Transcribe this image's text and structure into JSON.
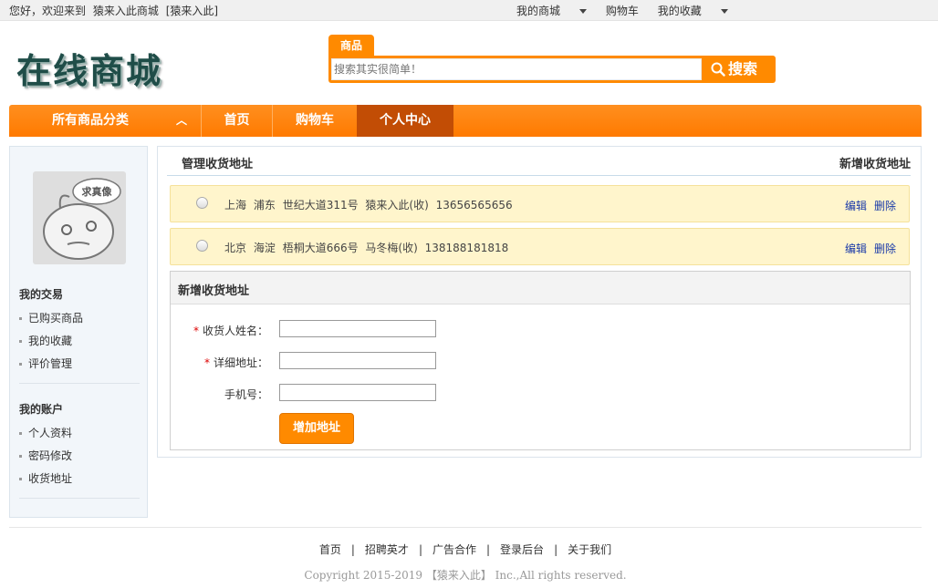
{
  "topbar": {
    "welcome": "您好，欢迎来到",
    "shop_name": "猿来入此商城",
    "user": "[猿来入此]",
    "links": [
      "我的商城",
      "购物车",
      "我的收藏"
    ]
  },
  "header": {
    "logo": "在线商城",
    "search_tab": "商品",
    "search_placeholder": "搜索其实很简单！",
    "search_button": "搜索"
  },
  "nav": {
    "category": "所有商品分类",
    "items": [
      "首页",
      "购物车",
      "个人中心"
    ],
    "active": "个人中心"
  },
  "sidebar": {
    "avatar_text": "求真像",
    "sections": [
      {
        "title": "我的交易",
        "items": [
          "已购买商品",
          "我的收藏",
          "评价管理"
        ]
      },
      {
        "title": "我的账户",
        "items": [
          "个人资料",
          "密码修改",
          "收货地址"
        ]
      }
    ]
  },
  "main": {
    "title": "管理收货地址",
    "add_link": "新增收货地址",
    "addresses": [
      {
        "province": "上海",
        "district": "浦东",
        "street": "世纪大道311号",
        "name": "猿来入此(收)",
        "phone": "13656565656"
      },
      {
        "province": "北京",
        "district": "海淀",
        "street": "梧桐大道666号",
        "name": "马冬梅(收)",
        "phone": "138188181818"
      }
    ],
    "edit_label": "编辑",
    "delete_label": "删除",
    "form": {
      "title": "新增收货地址",
      "fields": [
        {
          "label": "收货人姓名：",
          "required": true,
          "value": ""
        },
        {
          "label": "详细地址：",
          "required": true,
          "value": ""
        },
        {
          "label": "手机号：",
          "required": false,
          "value": ""
        }
      ],
      "submit": "增加地址"
    }
  },
  "footer": {
    "links": [
      "首页",
      "招聘英才",
      "广告合作",
      "登录后台",
      "关于我们"
    ],
    "separator": "|",
    "copyright": "Copyright 2015-2019 【猿来入此】 Inc.,All rights reserved."
  },
  "colors": {
    "accent": "#ff8a00",
    "nav_active": "#c24d05",
    "link": "#1a3aa8"
  }
}
